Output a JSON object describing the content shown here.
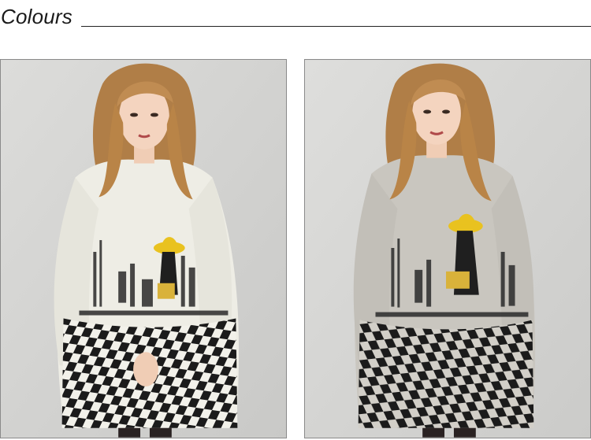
{
  "header": {
    "title": "Colours"
  },
  "variants": [
    {
      "id": "white",
      "dress_color": "#efeee6",
      "backdrop": "#d4d4d2"
    },
    {
      "id": "grey",
      "dress_color": "#cac7c0",
      "backdrop": "#d6d6d4"
    }
  ]
}
